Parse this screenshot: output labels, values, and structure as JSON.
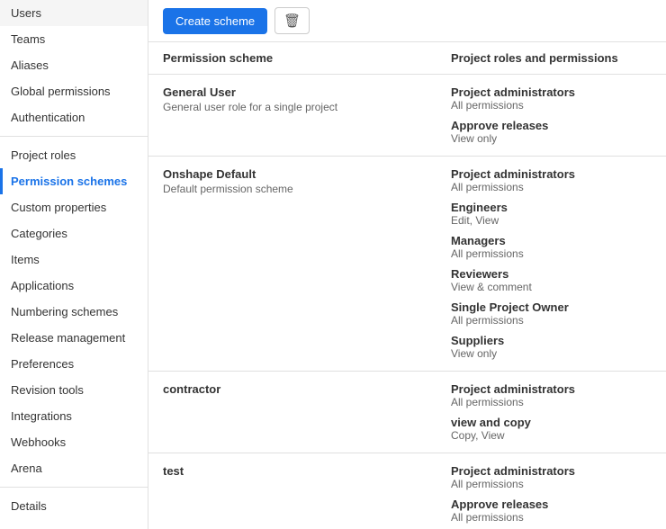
{
  "sidebar": {
    "items": [
      {
        "label": "Users",
        "active": false
      },
      {
        "label": "Teams",
        "active": false
      },
      {
        "label": "Aliases",
        "active": false
      },
      {
        "label": "Global permissions",
        "active": false
      },
      {
        "label": "Authentication",
        "active": false
      },
      {
        "label": "Project roles",
        "active": false
      },
      {
        "label": "Permission schemes",
        "active": true
      },
      {
        "label": "Custom properties",
        "active": false
      },
      {
        "label": "Categories",
        "active": false
      },
      {
        "label": "Items",
        "active": false
      },
      {
        "label": "Applications",
        "active": false
      },
      {
        "label": "Numbering schemes",
        "active": false
      },
      {
        "label": "Release management",
        "active": false
      },
      {
        "label": "Preferences",
        "active": false
      },
      {
        "label": "Revision tools",
        "active": false
      },
      {
        "label": "Integrations",
        "active": false
      },
      {
        "label": "Webhooks",
        "active": false
      },
      {
        "label": "Arena",
        "active": false
      },
      {
        "label": "Details",
        "active": false
      }
    ],
    "dividers_after": [
      4,
      17
    ]
  },
  "toolbar": {
    "create_label": "Create scheme",
    "delete_icon": "🗑"
  },
  "table": {
    "col1_header": "Permission scheme",
    "col2_header": "Project roles and permissions",
    "rows": [
      {
        "name": "General User",
        "desc": "General user role for a single project",
        "roles": [
          {
            "name": "Project administrators",
            "perm": "All permissions"
          },
          {
            "name": "Approve releases",
            "perm": "View only"
          }
        ]
      },
      {
        "name": "Onshape Default",
        "desc": "Default permission scheme",
        "roles": [
          {
            "name": "Project administrators",
            "perm": "All permissions"
          },
          {
            "name": "Engineers",
            "perm": "Edit, View"
          },
          {
            "name": "Managers",
            "perm": "All permissions"
          },
          {
            "name": "Reviewers",
            "perm": "View & comment"
          },
          {
            "name": "Single Project Owner",
            "perm": "All permissions"
          },
          {
            "name": "Suppliers",
            "perm": "View only"
          }
        ]
      },
      {
        "name": "contractor",
        "desc": "",
        "roles": [
          {
            "name": "Project administrators",
            "perm": "All permissions"
          },
          {
            "name": "view and copy",
            "perm": "Copy, View"
          }
        ]
      },
      {
        "name": "test",
        "desc": "",
        "roles": [
          {
            "name": "Project administrators",
            "perm": "All permissions"
          },
          {
            "name": "Approve releases",
            "perm": "All permissions"
          }
        ]
      }
    ]
  }
}
